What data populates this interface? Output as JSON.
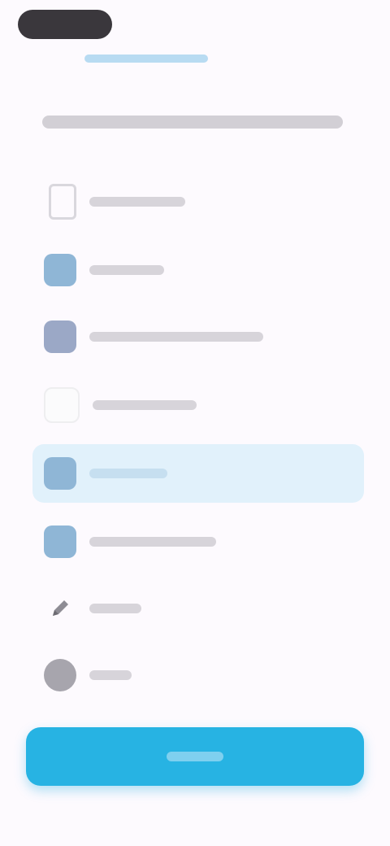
{
  "status_bar": {
    "time": ""
  },
  "header": {
    "back_label": ""
  },
  "question": {
    "text": ""
  },
  "options": [
    {
      "label": "",
      "icon": "document-icon",
      "selected": false
    },
    {
      "label": "",
      "icon": "blue-square-icon",
      "selected": false
    },
    {
      "label": "",
      "icon": "slate-square-icon",
      "selected": false
    },
    {
      "label": "",
      "icon": "blank-icon",
      "selected": false
    },
    {
      "label": "",
      "icon": "blue-square-icon",
      "selected": true
    },
    {
      "label": "",
      "icon": "blue-square-icon",
      "selected": false
    },
    {
      "label": "",
      "icon": "pencil-icon",
      "selected": false
    },
    {
      "label": "",
      "icon": "circle-icon",
      "selected": false
    }
  ],
  "primary_button": {
    "label": ""
  },
  "colors": {
    "accent": "#27b3e3",
    "selected_bg": "#e1f1fb",
    "background": "#fdfafe"
  }
}
